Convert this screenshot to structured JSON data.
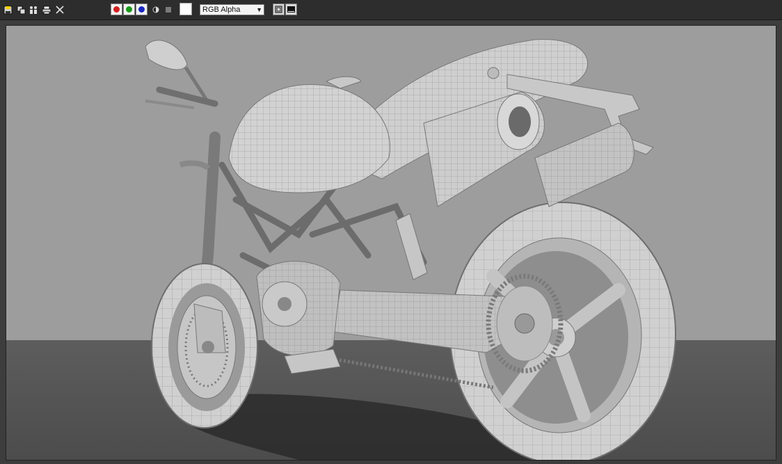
{
  "toolbar": {
    "icons": [
      "save-icon",
      "copy-icon",
      "clone-icon",
      "print-icon",
      "close-icon"
    ],
    "channels": [
      {
        "name": "red-channel",
        "color": "#d22020"
      },
      {
        "name": "green-channel",
        "color": "#1a9a1a"
      },
      {
        "name": "blue-channel",
        "color": "#1a2ac0"
      }
    ],
    "channel_select": "RGB Alpha",
    "swatch_color": "#ffffff"
  },
  "colors": {
    "backdrop": "#9b9b9b",
    "floor": "#555555",
    "frame": "#3d3d3d"
  }
}
